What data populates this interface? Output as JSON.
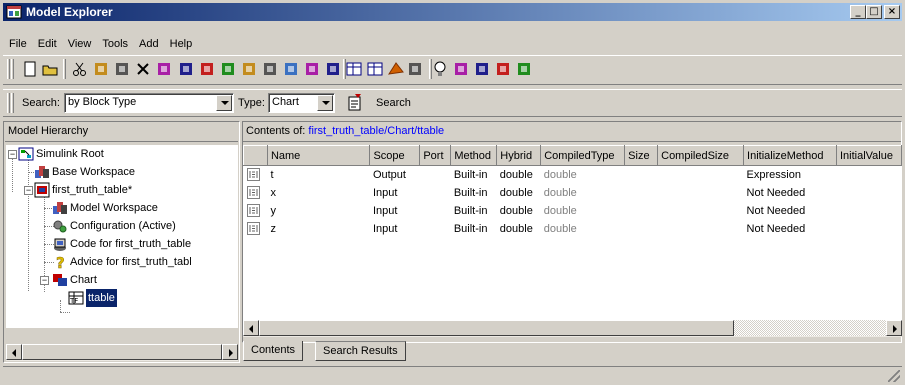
{
  "window": {
    "title": "Model Explorer",
    "controls": {
      "minimize": "_",
      "maximize": "□",
      "close": "×"
    }
  },
  "menu": [
    "File",
    "Edit",
    "View",
    "Tools",
    "Add",
    "Help"
  ],
  "toolbar_icons": [
    "new-icon",
    "open-icon",
    "cut-icon",
    "copy-icon",
    "paste-icon",
    "delete-icon",
    "add-model-icon",
    "add-chart-icon",
    "add-parameter-icon",
    "add-signal-icon",
    "add-data-icon",
    "add-event-icon",
    "add-state-icon",
    "add-function-icon",
    "add-record-icon",
    "table-view-icon",
    "detail-view-icon",
    "matlab-icon",
    "simulink-icon",
    "lightbulb-icon",
    "edit-icon",
    "toggle-icon",
    "swap-icon",
    "notes-icon"
  ],
  "search": {
    "label": "Search:",
    "mode": "by Block Type",
    "type_label": "Type:",
    "type_value": "Chart",
    "button_label": "Search"
  },
  "hierarchy": {
    "header": "Model Hierarchy",
    "items": [
      {
        "label": "Simulink Root",
        "icon": "simulink-root-icon"
      },
      {
        "label": "Base Workspace",
        "icon": "workspace-icon"
      },
      {
        "label": "first_truth_table*",
        "icon": "model-icon"
      },
      {
        "label": "Model Workspace",
        "icon": "workspace-icon"
      },
      {
        "label": "Configuration (Active)",
        "icon": "configuration-icon"
      },
      {
        "label": "Code for first_truth_table",
        "icon": "code-icon"
      },
      {
        "label": "Advice for first_truth_tabl",
        "icon": "advice-icon"
      },
      {
        "label": "Chart",
        "icon": "chart-icon"
      },
      {
        "label": "ttable",
        "icon": "truth-table-icon"
      }
    ]
  },
  "contents": {
    "header_prefix": "Contents of:",
    "path": "first_truth_table/Chart/ttable",
    "columns": [
      "Name",
      "Scope",
      "Port",
      "Method",
      "Hybrid",
      "CompiledType",
      "Size",
      "CompiledSize",
      "InitializeMethod",
      "InitialValue"
    ],
    "rows": [
      {
        "name": "t",
        "scope": "Output",
        "port": "",
        "method": "Built-in",
        "hybrid": "double",
        "compiled_type": "double",
        "size": "",
        "compiled_size": "",
        "initialize_method": "Expression",
        "initial_value": ""
      },
      {
        "name": "x",
        "scope": "Input",
        "port": "",
        "method": "Built-in",
        "hybrid": "double",
        "compiled_type": "double",
        "size": "",
        "compiled_size": "",
        "initialize_method": "Not Needed",
        "initial_value": ""
      },
      {
        "name": "y",
        "scope": "Input",
        "port": "",
        "method": "Built-in",
        "hybrid": "double",
        "compiled_type": "double",
        "size": "",
        "compiled_size": "",
        "initialize_method": "Not Needed",
        "initial_value": ""
      },
      {
        "name": "z",
        "scope": "Input",
        "port": "",
        "method": "Built-in",
        "hybrid": "double",
        "compiled_type": "double",
        "size": "",
        "compiled_size": "",
        "initialize_method": "Not Needed",
        "initial_value": ""
      }
    ]
  },
  "tabs": [
    "Contents",
    "Search Results"
  ],
  "colors": {
    "title_bar": "#0a246a",
    "selection": "#0a246a",
    "face": "#d4d0c8",
    "link": "#0000ff"
  }
}
